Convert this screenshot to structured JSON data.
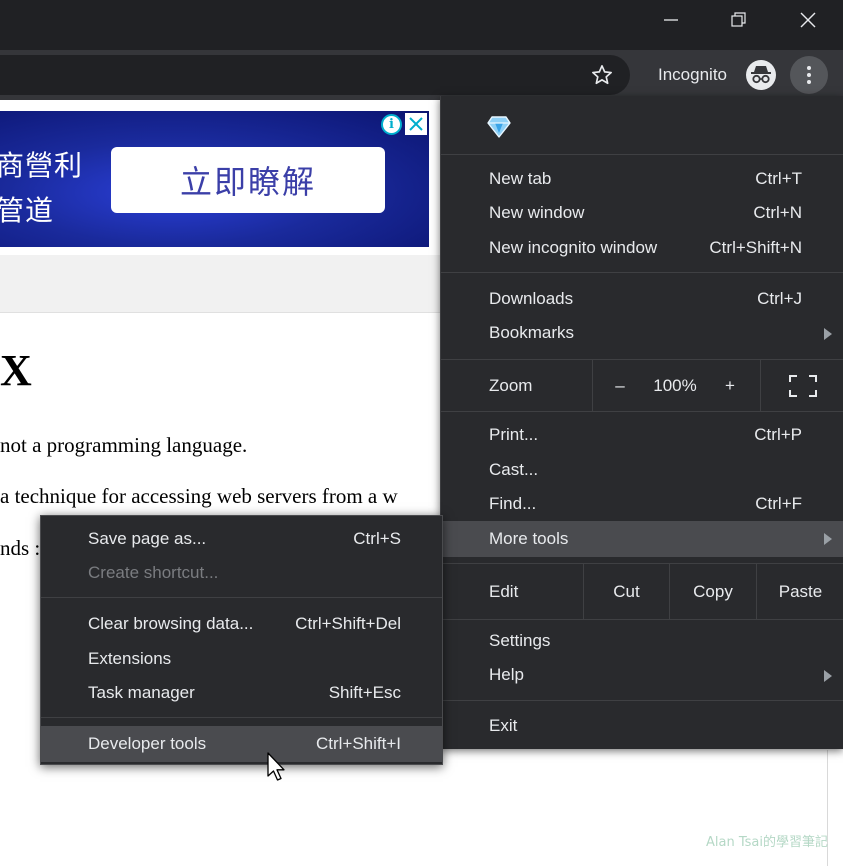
{
  "window": {
    "controls": [
      "minimize-icon",
      "restore-icon",
      "close-icon"
    ]
  },
  "toolbar": {
    "incognito_label": "Incognito",
    "bookmark_icon": "star-icon",
    "incognito_icon": "incognito-icon",
    "menu_icon": "kebab-menu-icon"
  },
  "page": {
    "ad": {
      "line1": "商營利",
      "line2": "管道",
      "button": "立即瞭解",
      "info_icon": "i"
    },
    "heading": "X",
    "para1": "not a programming language.",
    "para2": "a technique for accessing web servers from a w",
    "para3": "nds :",
    "watermark": "Alan Tsai的學習筆記"
  },
  "menu": {
    "header_icon": "diamond-icon",
    "new_tab": {
      "label": "New tab",
      "shortcut": "Ctrl+T"
    },
    "new_window": {
      "label": "New window",
      "shortcut": "Ctrl+N"
    },
    "new_incognito": {
      "label": "New incognito window",
      "shortcut": "Ctrl+Shift+N"
    },
    "downloads": {
      "label": "Downloads",
      "shortcut": "Ctrl+J"
    },
    "bookmarks": {
      "label": "Bookmarks"
    },
    "zoom": {
      "label": "Zoom",
      "minus": "–",
      "value": "100%",
      "plus": "+"
    },
    "print": {
      "label": "Print...",
      "shortcut": "Ctrl+P"
    },
    "cast": {
      "label": "Cast..."
    },
    "find": {
      "label": "Find...",
      "shortcut": "Ctrl+F"
    },
    "more_tools": {
      "label": "More tools"
    },
    "edit": {
      "label": "Edit",
      "cut": "Cut",
      "copy": "Copy",
      "paste": "Paste"
    },
    "settings": {
      "label": "Settings"
    },
    "help": {
      "label": "Help"
    },
    "exit": {
      "label": "Exit"
    }
  },
  "submenu": {
    "save_page": {
      "label": "Save page as...",
      "shortcut": "Ctrl+S"
    },
    "create_shortcut": {
      "label": "Create shortcut..."
    },
    "clear_data": {
      "label": "Clear browsing data...",
      "shortcut": "Ctrl+Shift+Del"
    },
    "extensions": {
      "label": "Extensions"
    },
    "task_manager": {
      "label": "Task manager",
      "shortcut": "Shift+Esc"
    },
    "dev_tools": {
      "label": "Developer tools",
      "shortcut": "Ctrl+Shift+I"
    }
  },
  "colors": {
    "titlebar": "#202124",
    "toolbar": "#35363a",
    "menu_bg": "#292a2d",
    "menu_highlight": "#4a4b4f",
    "menu_text": "#e8eaed",
    "disabled_text": "#7a7c80"
  }
}
